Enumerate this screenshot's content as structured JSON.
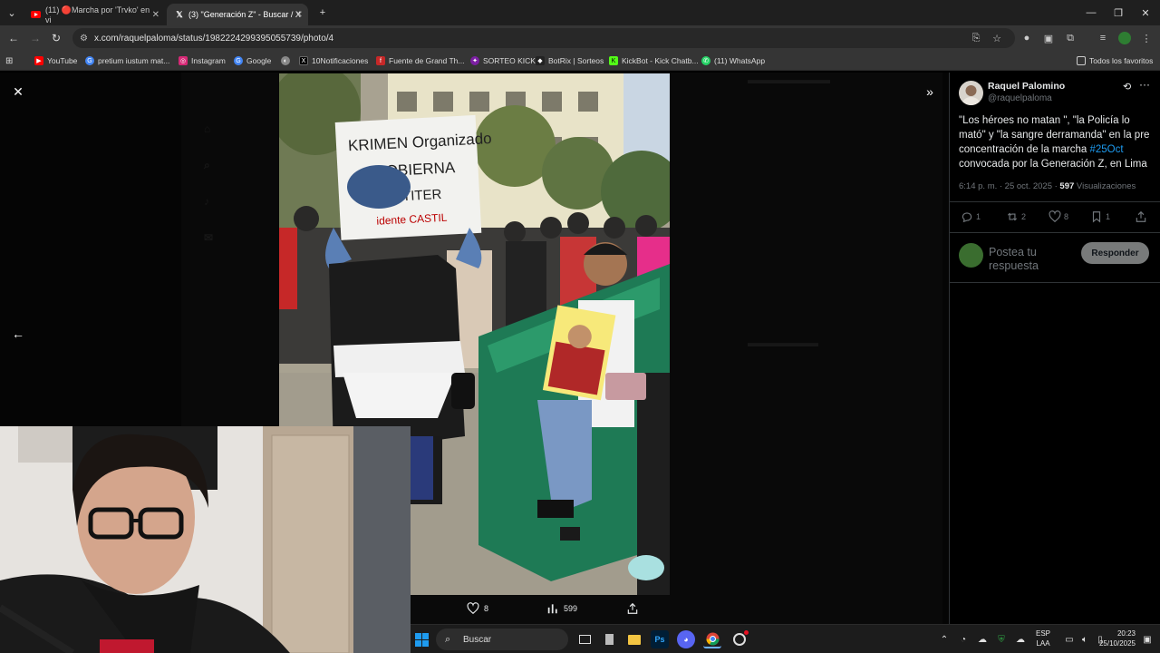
{
  "browser": {
    "tabs": [
      {
        "label": "(11) 🔴Marcha por 'Trvko' en vi",
        "icon": "youtube-icon"
      },
      {
        "label": "(3) \"Generación Z\" - Buscar / X",
        "icon": "x-icon"
      }
    ],
    "new_tab": "+",
    "url": "x.com/raquelpaloma/status/1982224299395055739/photo/4",
    "bookmarks": [
      {
        "label": "YouTube",
        "color": "#ff0000"
      },
      {
        "label": "pretium iustum mat...",
        "color": "#4285f4"
      },
      {
        "label": "Instagram",
        "color": "#d62976"
      },
      {
        "label": "Google",
        "color": "#4285f4"
      },
      {
        "label": "",
        "color": "#888888"
      },
      {
        "label": "10Notificaciones",
        "color": "#000000"
      },
      {
        "label": "Fuente de Grand Th...",
        "color": "#c62828"
      },
      {
        "label": "SORTEO KICK",
        "color": "#7b1fa2"
      },
      {
        "label": "BotRix | Sorteos",
        "color": "#222222"
      },
      {
        "label": "KickBot - Kick Chatb...",
        "color": "#53fc18"
      },
      {
        "label": "(11) WhatsApp",
        "color": "#25d366"
      }
    ],
    "all_bookmarks": "Todos los favoritos"
  },
  "photo_bar": {
    "likes": "8",
    "views": "599"
  },
  "tweet": {
    "name": "Raquel Palomino",
    "handle": "@raquelpaloma",
    "text_before": "\"Los héroes no matan \", \"la Policía lo mató\" y \"la sangre derramanda\" en la pre concentración de la marcha ",
    "hashtag": "#25Oct",
    "text_after": " convocada por la Generación Z, en Lima",
    "time": "6:14 p. m. · 25 oct. 2025 · ",
    "views_count": "597",
    "views_label": " Visualizaciones",
    "replies": "1",
    "reposts": "2",
    "likes": "8",
    "bookmarks": "1",
    "reply_placeholder": "Postea tu respuesta",
    "reply_button": "Responder"
  },
  "photo_sign": {
    "line1": "KRIMEN Organizado",
    "line2": "GOBIERNA",
    "line3": "TITER",
    "line4": "idente CASTIL"
  },
  "taskbar": {
    "search": "Buscar",
    "lang": "ESP",
    "lang2": "LAA",
    "time": "20:23",
    "date": "25/10/2025"
  },
  "colors": {
    "accent": "#1d9bf0",
    "bg": "#000000"
  }
}
